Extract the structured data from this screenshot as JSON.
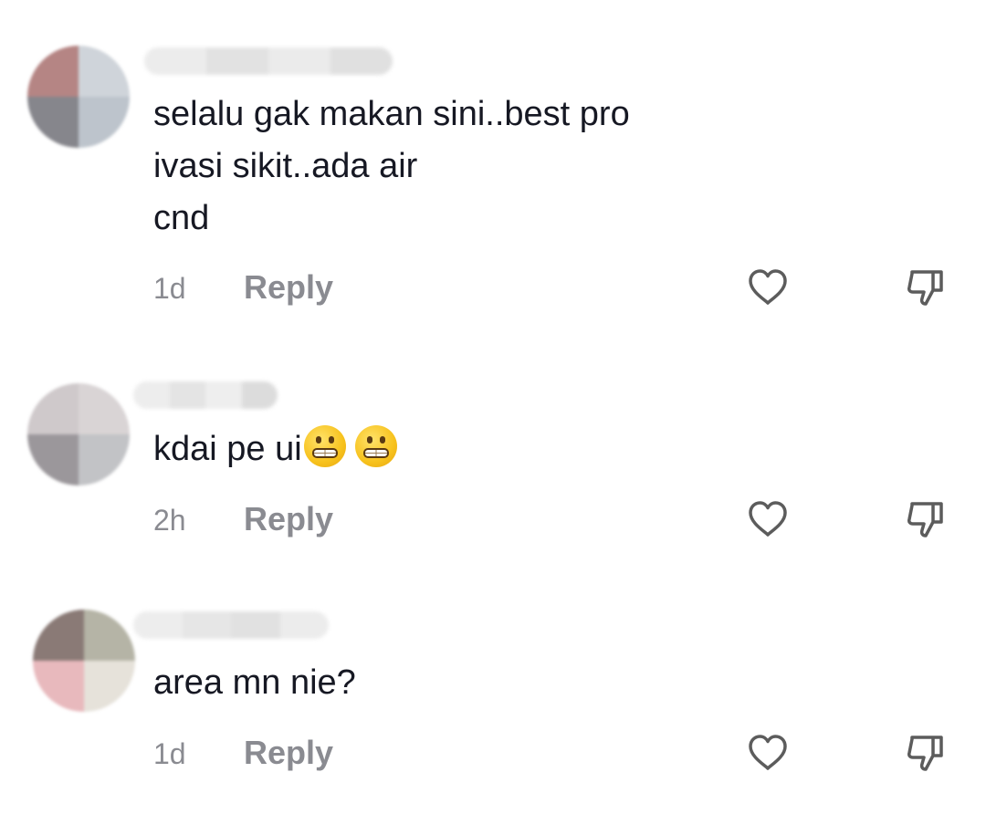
{
  "comments": [
    {
      "text": "selalu gak makan sini..best pro\nivasi sikit..ada air\ncnd",
      "time": "1d",
      "reply_label": "Reply",
      "avatar_colors": [
        "#b58584",
        "#cfd4da",
        "#86868c",
        "#bdc4cc"
      ],
      "username_colors": [
        "#ececec",
        "#e2e2e2",
        "#ebebeb",
        "#e0e0e0"
      ]
    },
    {
      "text": "kdai pe ui",
      "time": "2h",
      "reply_label": "Reply",
      "avatar_colors": [
        "#cfc9cb",
        "#d9d4d5",
        "#9b979b",
        "#c2c3c6"
      ],
      "username_colors": [
        "#ededed",
        "#e4e4e4",
        "#eeeeee",
        "#dcdcdc"
      ],
      "emojis": [
        "grimacing-face-emoji",
        "grimacing-face-emoji"
      ]
    },
    {
      "text": "area mn nie?",
      "time": "1d",
      "reply_label": "Reply",
      "avatar_colors": [
        "#8a7a76",
        "#b5b4a6",
        "#e8b9bd",
        "#e6e2da"
      ],
      "username_colors": [
        "#ededed",
        "#e6e6e6",
        "#e1e1e1",
        "#ececec"
      ]
    }
  ],
  "icons": {
    "like": "heart-outline-icon",
    "dislike": "thumbs-down-outline-icon"
  },
  "colors": {
    "text": "#161823",
    "secondary": "#8a8b91",
    "icon": "#5c5c5c"
  }
}
